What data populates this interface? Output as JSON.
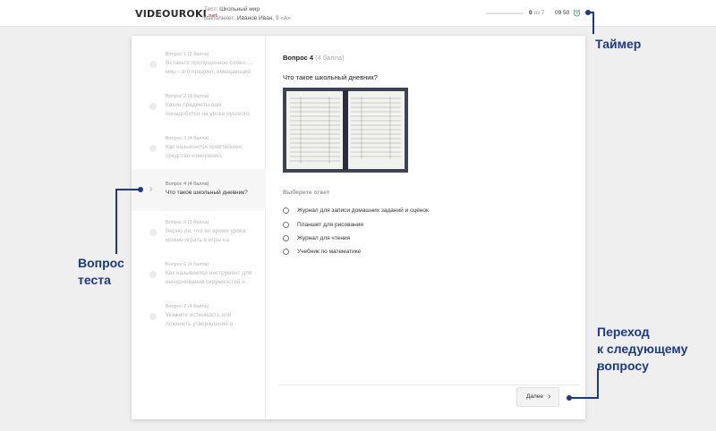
{
  "header": {
    "logo_text": "VIDEOUROKI",
    "logo_suffix": ".net",
    "test_label": "Тест:",
    "test_name": "Школьный мир",
    "executor_label": "Выполняет:",
    "executor_name": "Иванов Иван",
    "executor_class": ", 9 «А»",
    "progress_current": "0",
    "progress_of": "из 7",
    "timer": "09 50",
    "accent_color": "#3aa76d"
  },
  "sidebar": {
    "items": [
      {
        "head": "Вопрос 1 (3 балла)",
        "line1": "Вставьте пропущенное слово. ...",
        "line2": "мир - это предмет, вмещающий"
      },
      {
        "head": "Вопрос 2 (4 балла)",
        "line1": "Какие предметы вам",
        "line2": "понадобятся на уроке русского"
      },
      {
        "head": "Вопрос 3 (4 балла)",
        "line1": "Как называется простейшее",
        "line2": "средство измерений,"
      },
      {
        "head": "Вопрос 4 (4 балла)",
        "line1": "Что такое школьный дневник?",
        "line2": ""
      },
      {
        "head": "Вопрос 5 (3 балла)",
        "line1": "Верно ли, что во время урока",
        "line2": "можно играть в игры на"
      },
      {
        "head": "Вопрос 6 (4 балла)",
        "line1": "Как называется инструмент для",
        "line2": "вычерчивания окружностей и"
      },
      {
        "head": "Вопрос 7 (4 балла)",
        "line1": "Укажите истинность или",
        "line2": "ложность утверждений о"
      }
    ]
  },
  "main": {
    "title": "Вопрос 4",
    "title_points": "(4 балла)",
    "question": "Что такое школьный дневник?",
    "image_icon": "open-diary-image",
    "answer_label": "Выберите ответ",
    "options": [
      "Журнал для записи домашних заданий и оценок",
      "Планшет для рисования",
      "Журнал для чтения",
      "Учебник по математике"
    ],
    "next_label": "Далее"
  },
  "annotations": {
    "timer": "Таймер",
    "question_line1": "Вопрос",
    "question_line2": "теста",
    "next_line1": "Переход",
    "next_line2": "к следующему",
    "next_line3": "вопросу",
    "color": "#1b3a8c"
  }
}
